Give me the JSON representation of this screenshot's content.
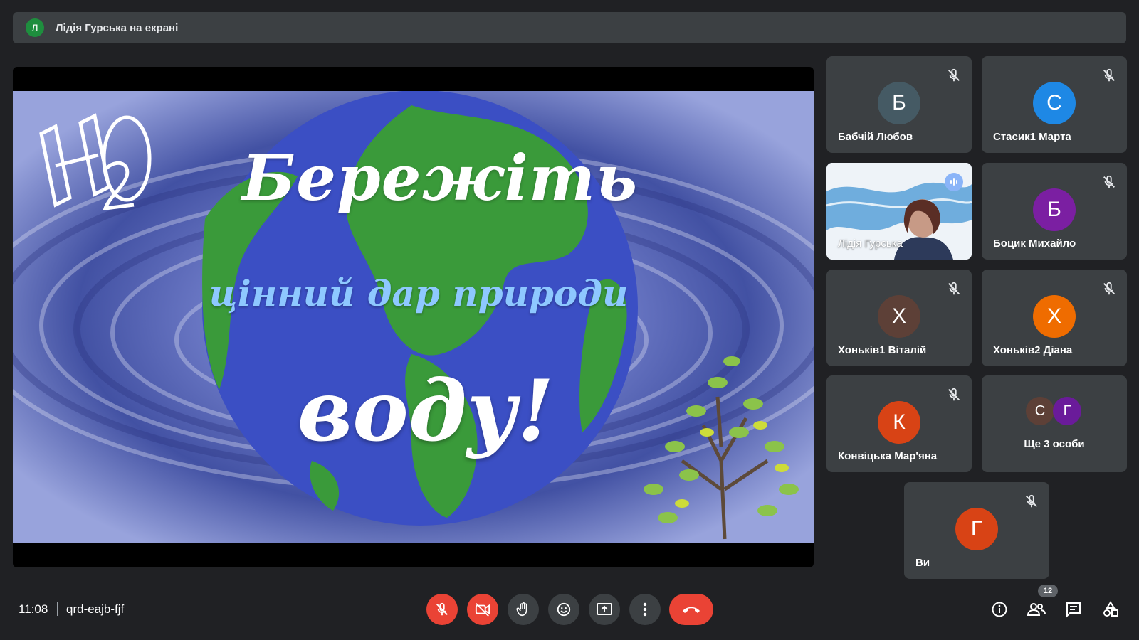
{
  "banner": {
    "avatar_letter": "Л",
    "text": "Лідія Гурська на екрані"
  },
  "slide": {
    "logo": "H2O",
    "line1": "Бережіть",
    "line2": "цінний дар природи",
    "line3": "воду!"
  },
  "participants": [
    {
      "letter": "Б",
      "name": "Бабчій Любов",
      "color": "#455a64",
      "muted": true
    },
    {
      "letter": "С",
      "name": "Стасик1 Марта",
      "color": "#1e88e5",
      "muted": true
    },
    {
      "letter": "",
      "name": "Лідія Гурська",
      "color": "",
      "muted": false,
      "speaking": true
    },
    {
      "letter": "Б",
      "name": "Боцик Михайло",
      "color": "#7b1fa2",
      "muted": true
    },
    {
      "letter": "Х",
      "name": "Хоньків1 Віталій",
      "color": "#5d4037",
      "muted": true
    },
    {
      "letter": "Х",
      "name": "Хоньків2 Діана",
      "color": "#ef6c00",
      "muted": true
    },
    {
      "letter": "К",
      "name": "Конвіцька Мар'яна",
      "color": "#d84315",
      "muted": true
    },
    {
      "letter": "Г",
      "name": "Ви",
      "color": "#d84315",
      "muted": true
    }
  ],
  "more": {
    "text": "Ще 3 особи",
    "letters": [
      "С",
      "Г"
    ],
    "colors": [
      "#5d4037",
      "#6a1b9a"
    ]
  },
  "bottom": {
    "time": "11:08",
    "meeting_code": "qrd-eajb-fjf",
    "people_count": "12"
  },
  "icons": {
    "mic": "mic-off-icon",
    "camera": "videocam-off-icon",
    "hand": "raise-hand-icon",
    "emoji": "emoji-icon",
    "present": "present-screen-icon",
    "more": "more-vert-icon",
    "end": "call-end-icon",
    "info": "info-icon",
    "people": "people-icon",
    "chat": "chat-icon",
    "activities": "activities-icon"
  },
  "colors": {
    "end_call": "#ea4335",
    "tile_bg": "#3c4043",
    "speaking": "#8ab4f8",
    "globe_ocean": "#3b4fc4",
    "globe_land": "#3a9a3a"
  }
}
